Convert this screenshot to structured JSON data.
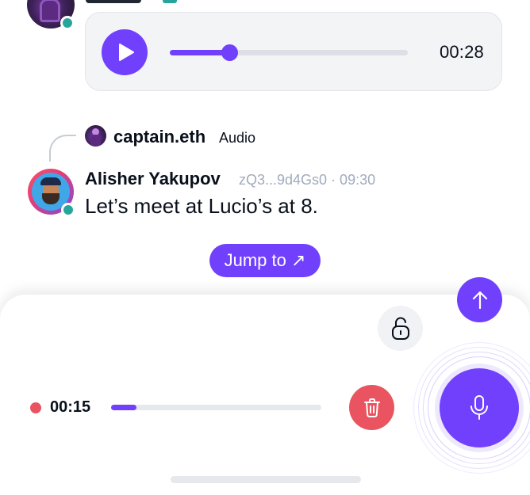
{
  "audio_message": {
    "duration": "00:28",
    "progress": 0.25,
    "play_icon": "play-icon"
  },
  "reply": {
    "author": "captain.eth",
    "kind": "Audio"
  },
  "message": {
    "author": "Alisher Yakupov",
    "meta": "zQ3...9d4Gs0 · 09:30",
    "text": "Let’s meet at Lucio’s at 8."
  },
  "jump_button": {
    "label": "Jump to ↗"
  },
  "recorder": {
    "elapsed": "00:15",
    "progress": 0.12,
    "icons": {
      "send": "arrow-up-icon",
      "lock": "lock-open-icon",
      "delete": "trash-icon",
      "mic": "microphone-icon"
    }
  },
  "colors": {
    "accent": "#7140fd",
    "danger": "#e95460",
    "online": "#26a69a",
    "bubble_bg": "#f3f4f6",
    "muted_text": "#a1abbd"
  }
}
